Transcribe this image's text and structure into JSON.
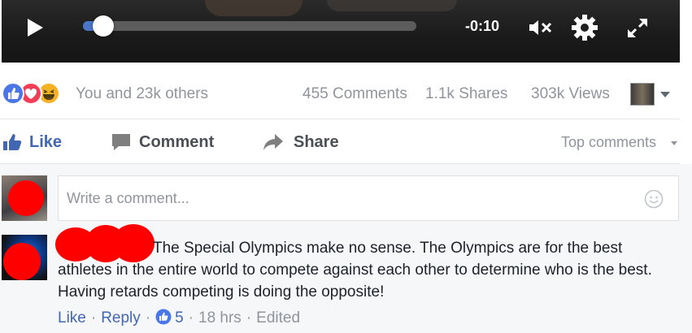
{
  "player": {
    "time_remaining": "-0:10",
    "progress_fraction": 0.06,
    "icons": [
      "play-icon",
      "mute-icon",
      "gear-icon",
      "fullscreen-icon"
    ]
  },
  "stats": {
    "reaction_text": "You and 23k others",
    "comments": "455 Comments",
    "shares": "1.1k Shares",
    "views": "303k Views",
    "reaction_icons": [
      "like-reaction-icon",
      "love-reaction-icon",
      "haha-reaction-icon"
    ]
  },
  "actions": {
    "like": "Like",
    "comment": "Comment",
    "share": "Share",
    "sort": "Top comments"
  },
  "composer": {
    "placeholder": "Write a comment..."
  },
  "comment": {
    "text_first_line": "The Special Olympics make no sense. The Olympics are for the best",
    "text_rest": "athletes in the entire world to compete against each other to determine who is the best. Having retards competing is doing the opposite!",
    "like_label": "Like",
    "reply_label": "Reply",
    "like_count": "5",
    "time": "18 hrs",
    "edited": "Edited"
  },
  "colors": {
    "accent": "#4267b2",
    "muted": "#90949c",
    "redaction": "#ff0000",
    "progress": "#4a76c8"
  }
}
